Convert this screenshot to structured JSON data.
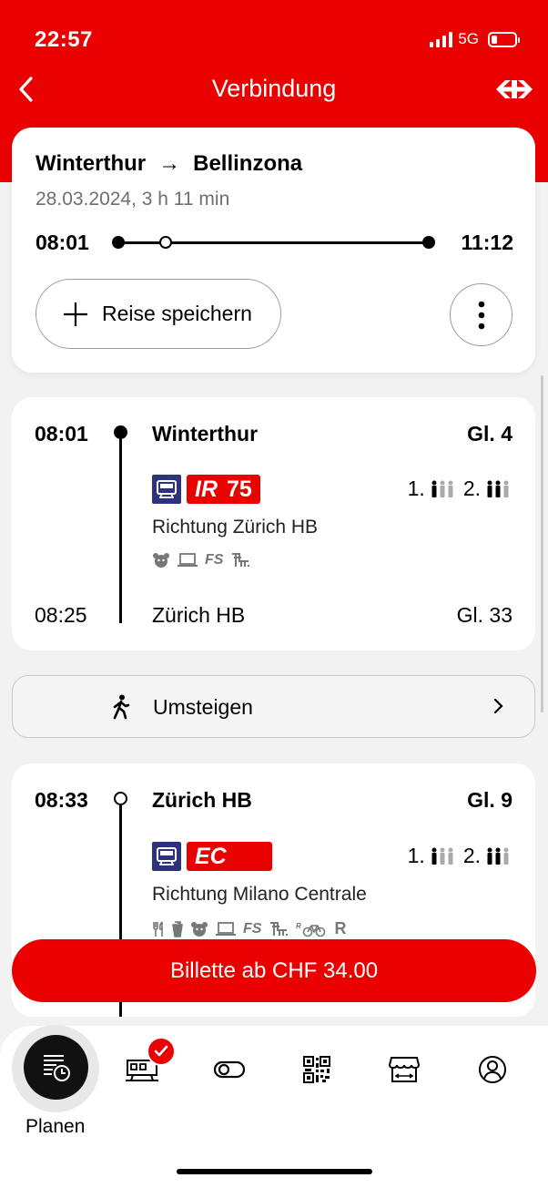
{
  "status_bar": {
    "time": "22:57",
    "network": "5G",
    "battery_level": 0.2
  },
  "header": {
    "title": "Verbindung",
    "back_icon": "chevron-left-icon",
    "logo": "sbb-logo-icon"
  },
  "summary": {
    "origin": "Winterthur",
    "arrow": "→",
    "destination": "Bellinzona",
    "meta": "28.03.2024, 3 h 11 min",
    "departure": "08:01",
    "arrival": "11:12",
    "save_label": "Reise speichern",
    "more_icon": "more-vertical-icon"
  },
  "legs": [
    {
      "dep_time": "08:01",
      "dep_station": "Winterthur",
      "dep_track": "Gl. 4",
      "train_category": "IR",
      "train_number": "75",
      "class1": "1.",
      "class2": "2.",
      "direction": "Richtung Zürich HB",
      "attrs": [
        "family-zone-icon",
        "business-zone-icon",
        "FS",
        "low-floor-icon"
      ],
      "arr_time": "08:25",
      "arr_station": "Zürich HB",
      "arr_track": "Gl. 33"
    },
    {
      "dep_time": "08:33",
      "dep_station": "Zürich HB",
      "dep_track": "Gl. 9",
      "train_category": "EC",
      "class1": "1.",
      "class2": "2.",
      "direction": "Richtung Milano Centrale",
      "attrs": [
        "restaurant-icon",
        "minibar-icon",
        "family-zone-icon",
        "business-zone-icon",
        "FS",
        "low-floor-icon",
        "bike-reservation-icon",
        "R"
      ]
    }
  ],
  "transfer": {
    "label": "Umsteigen",
    "icon": "walking-icon"
  },
  "ticket_button": {
    "label": "Billette ab CHF 34.00"
  },
  "tabs": {
    "active_label": "Planen",
    "items": [
      "timetable-icon",
      "train-icon",
      "toggle-icon",
      "qr-code-icon",
      "shop-icon",
      "profile-icon"
    ]
  },
  "colors": {
    "accent": "#eb0000",
    "pictogram_blue": "#2d327d"
  }
}
